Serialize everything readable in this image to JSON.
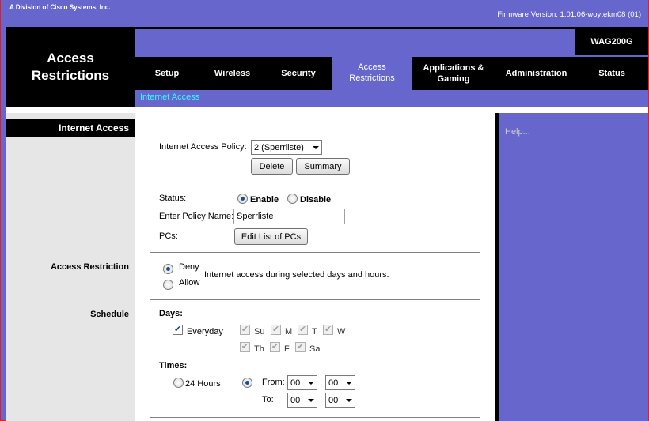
{
  "top": {
    "division": "A Division of Cisco Systems, Inc.",
    "firmware": "Firmware Version: 1.01.06-woytekm08 (01)"
  },
  "header": {
    "title": "Access Restrictions",
    "model": "WAG200G"
  },
  "tabs": [
    {
      "label": "Setup"
    },
    {
      "label": "Wireless"
    },
    {
      "label": "Security"
    },
    {
      "label": "Access Restrictions",
      "active": true
    },
    {
      "label": "Applications & Gaming"
    },
    {
      "label": "Administration"
    },
    {
      "label": "Status"
    }
  ],
  "subnav": {
    "item": "Internet Access"
  },
  "sidebar": {
    "heading": "Internet Access",
    "access_restriction": "Access Restriction",
    "schedule": "Schedule"
  },
  "help": {
    "text": "Help..."
  },
  "policy": {
    "label": "Internet Access Policy:",
    "selected": "2 (Sperrliste)",
    "delete_btn": "Delete",
    "summary_btn": "Summary"
  },
  "status": {
    "label": "Status:",
    "enable": "Enable",
    "disable": "Disable",
    "selected": "Enable"
  },
  "policy_name": {
    "label": "Enter Policy Name:",
    "value": "Sperrliste"
  },
  "pcs": {
    "label": "PCs:",
    "button": "Edit List of PCs"
  },
  "restriction": {
    "deny": "Deny",
    "allow": "Allow",
    "selected": "Deny",
    "description": "Internet access during selected days and hours."
  },
  "schedule": {
    "days_label": "Days:",
    "everyday": "Everyday",
    "everyday_checked": true,
    "days": [
      {
        "label": "Su",
        "checked": true
      },
      {
        "label": "M",
        "checked": true
      },
      {
        "label": "T",
        "checked": true
      },
      {
        "label": "W",
        "checked": true
      },
      {
        "label": "Th",
        "checked": true
      },
      {
        "label": "F",
        "checked": true
      },
      {
        "label": "Sa",
        "checked": true
      }
    ],
    "times_label": "Times:",
    "hours24": "24 Hours",
    "from_label": "From:",
    "to_label": "To:",
    "from_h": "00",
    "from_m": "00",
    "to_h": "00",
    "to_m": "00",
    "colon": ":"
  }
}
